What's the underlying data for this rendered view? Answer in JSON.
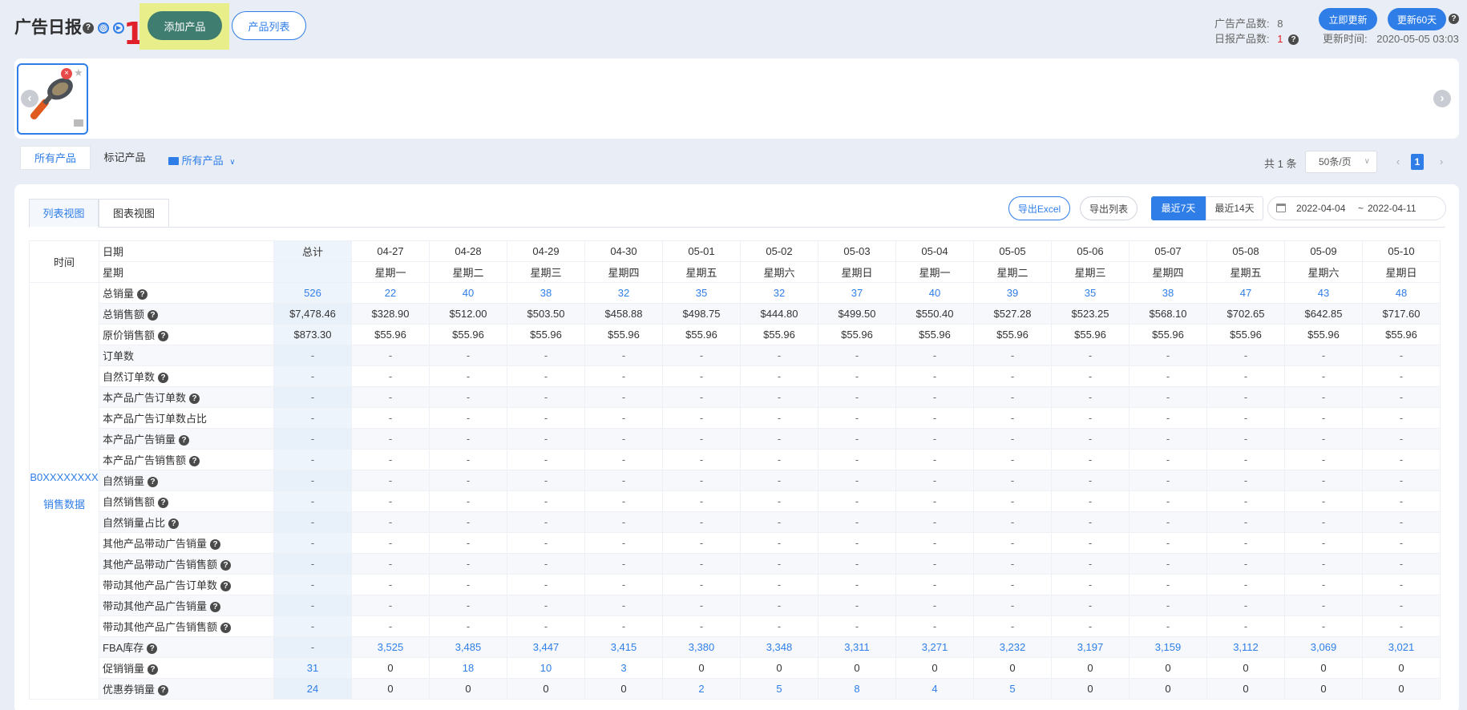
{
  "header": {
    "title": "广告日报",
    "add_button": "添加产品",
    "list_button": "产品列表",
    "annotation": "1",
    "ad_count_label": "广告产品数:",
    "ad_count_value": "8",
    "daily_count_label": "日报产品数:",
    "daily_count_value": "1",
    "update_now": "立即更新",
    "update_60": "更新60天",
    "update_time_label": "更新时间:",
    "update_time_value": "2020-05-05 03:03"
  },
  "filters": {
    "tab_all": "所有产品",
    "tab_marked": "标记产品",
    "folder": "所有产品",
    "total": "共 1 条",
    "page_size": "50条/页",
    "page": "1"
  },
  "panel": {
    "tab_list": "列表视图",
    "tab_chart": "图表视图",
    "export_excel": "导出Excel",
    "export_list": "导出列表",
    "last7": "最近7天",
    "last14": "最近14天",
    "date_from": "2022-04-04",
    "date_sep": "~",
    "date_to": "2022-04-11"
  },
  "table": {
    "time_label": "时间",
    "date_label": "日期",
    "weekday_label": "星期",
    "total_label": "总计",
    "asin": "B0XXXXXXXX",
    "sales_data": "销售数据",
    "dates": [
      "04-27",
      "04-28",
      "04-29",
      "04-30",
      "05-01",
      "05-02",
      "05-03",
      "05-04",
      "05-05",
      "05-06",
      "05-07",
      "05-08",
      "05-09",
      "05-10"
    ],
    "weekdays": [
      "星期一",
      "星期二",
      "星期三",
      "星期四",
      "星期五",
      "星期六",
      "星期日",
      "星期一",
      "星期二",
      "星期三",
      "星期四",
      "星期五",
      "星期六",
      "星期日"
    ],
    "rows": [
      {
        "label": "总销量",
        "help": true,
        "total": "526",
        "vals": [
          "22",
          "40",
          "38",
          "32",
          "35",
          "32",
          "37",
          "40",
          "39",
          "35",
          "38",
          "47",
          "43",
          "48"
        ],
        "blue": true
      },
      {
        "label": "总销售额",
        "help": true,
        "total": "$7,478.46",
        "vals": [
          "$328.90",
          "$512.00",
          "$503.50",
          "$458.88",
          "$498.75",
          "$444.80",
          "$499.50",
          "$550.40",
          "$527.28",
          "$523.25",
          "$568.10",
          "$702.65",
          "$642.85",
          "$717.60"
        ]
      },
      {
        "label": "原价销售额",
        "help": true,
        "total": "$873.30",
        "vals": [
          "$55.96",
          "$55.96",
          "$55.96",
          "$55.96",
          "$55.96",
          "$55.96",
          "$55.96",
          "$55.96",
          "$55.96",
          "$55.96",
          "$55.96",
          "$55.96",
          "$55.96",
          "$55.96"
        ]
      },
      {
        "label": "订单数",
        "help": false,
        "total": "-",
        "vals": [
          "-",
          "-",
          "-",
          "-",
          "-",
          "-",
          "-",
          "-",
          "-",
          "-",
          "-",
          "-",
          "-",
          "-"
        ]
      },
      {
        "label": "自然订单数",
        "help": true,
        "total": "-",
        "vals": [
          "-",
          "-",
          "-",
          "-",
          "-",
          "-",
          "-",
          "-",
          "-",
          "-",
          "-",
          "-",
          "-",
          "-"
        ]
      },
      {
        "label": "本产品广告订单数",
        "help": true,
        "total": "-",
        "vals": [
          "-",
          "-",
          "-",
          "-",
          "-",
          "-",
          "-",
          "-",
          "-",
          "-",
          "-",
          "-",
          "-",
          "-"
        ]
      },
      {
        "label": "本产品广告订单数占比",
        "help": false,
        "total": "-",
        "vals": [
          "-",
          "-",
          "-",
          "-",
          "-",
          "-",
          "-",
          "-",
          "-",
          "-",
          "-",
          "-",
          "-",
          "-"
        ]
      },
      {
        "label": "本产品广告销量",
        "help": true,
        "total": "-",
        "vals": [
          "-",
          "-",
          "-",
          "-",
          "-",
          "-",
          "-",
          "-",
          "-",
          "-",
          "-",
          "-",
          "-",
          "-"
        ]
      },
      {
        "label": "本产品广告销售额",
        "help": true,
        "total": "-",
        "vals": [
          "-",
          "-",
          "-",
          "-",
          "-",
          "-",
          "-",
          "-",
          "-",
          "-",
          "-",
          "-",
          "-",
          "-"
        ]
      },
      {
        "label": "自然销量",
        "help": true,
        "total": "-",
        "vals": [
          "-",
          "-",
          "-",
          "-",
          "-",
          "-",
          "-",
          "-",
          "-",
          "-",
          "-",
          "-",
          "-",
          "-"
        ]
      },
      {
        "label": "自然销售额",
        "help": true,
        "total": "-",
        "vals": [
          "-",
          "-",
          "-",
          "-",
          "-",
          "-",
          "-",
          "-",
          "-",
          "-",
          "-",
          "-",
          "-",
          "-"
        ]
      },
      {
        "label": "自然销量占比",
        "help": true,
        "total": "-",
        "vals": [
          "-",
          "-",
          "-",
          "-",
          "-",
          "-",
          "-",
          "-",
          "-",
          "-",
          "-",
          "-",
          "-",
          "-"
        ]
      },
      {
        "label": "其他产品带动广告销量",
        "help": true,
        "total": "-",
        "vals": [
          "-",
          "-",
          "-",
          "-",
          "-",
          "-",
          "-",
          "-",
          "-",
          "-",
          "-",
          "-",
          "-",
          "-"
        ]
      },
      {
        "label": "其他产品带动广告销售额",
        "help": true,
        "total": "-",
        "vals": [
          "-",
          "-",
          "-",
          "-",
          "-",
          "-",
          "-",
          "-",
          "-",
          "-",
          "-",
          "-",
          "-",
          "-"
        ]
      },
      {
        "label": "带动其他产品广告订单数",
        "help": true,
        "total": "-",
        "vals": [
          "-",
          "-",
          "-",
          "-",
          "-",
          "-",
          "-",
          "-",
          "-",
          "-",
          "-",
          "-",
          "-",
          "-"
        ]
      },
      {
        "label": "带动其他产品广告销量",
        "help": true,
        "total": "-",
        "vals": [
          "-",
          "-",
          "-",
          "-",
          "-",
          "-",
          "-",
          "-",
          "-",
          "-",
          "-",
          "-",
          "-",
          "-"
        ]
      },
      {
        "label": "带动其他产品广告销售额",
        "help": true,
        "total": "-",
        "vals": [
          "-",
          "-",
          "-",
          "-",
          "-",
          "-",
          "-",
          "-",
          "-",
          "-",
          "-",
          "-",
          "-",
          "-"
        ]
      },
      {
        "label": "FBA库存",
        "help": true,
        "total": "-",
        "vals": [
          "3,525",
          "3,485",
          "3,447",
          "3,415",
          "3,380",
          "3,348",
          "3,311",
          "3,271",
          "3,232",
          "3,197",
          "3,159",
          "3,112",
          "3,069",
          "3,021"
        ],
        "blue": true
      },
      {
        "label": "促销销量",
        "help": true,
        "total": "31",
        "vals": [
          "0",
          "18",
          "10",
          "3",
          "0",
          "0",
          "0",
          "0",
          "0",
          "0",
          "0",
          "0",
          "0",
          "0"
        ],
        "blueNonZero": true
      },
      {
        "label": "优惠券销量",
        "help": true,
        "total": "24",
        "vals": [
          "0",
          "0",
          "0",
          "0",
          "2",
          "5",
          "8",
          "4",
          "5",
          "0",
          "0",
          "0",
          "0",
          "0"
        ],
        "blueNonZero": true
      }
    ]
  }
}
